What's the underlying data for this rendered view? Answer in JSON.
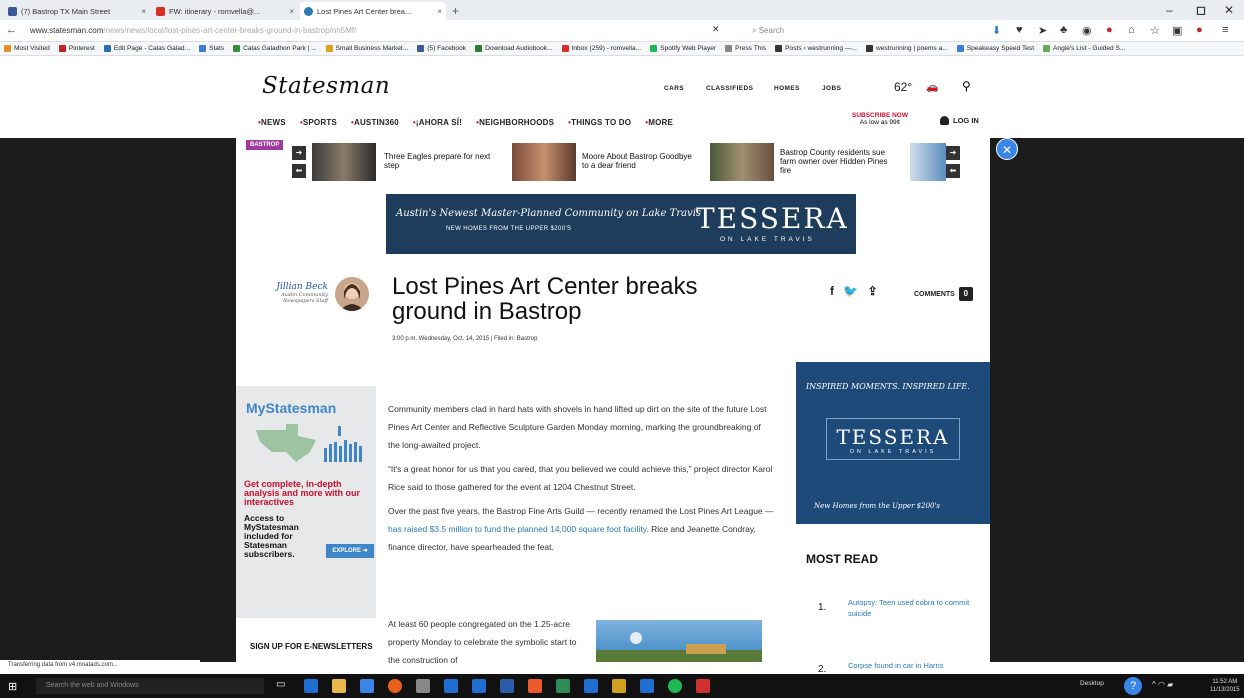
{
  "browser": {
    "tabs": [
      {
        "label": "(7) Bastrop TX Main Street",
        "close": "×",
        "color": "#3b5998"
      },
      {
        "label": "FW: itinerary - romvella@...",
        "close": "×",
        "color": "#d93025"
      },
      {
        "label": "Lost Pines Art Center brea...",
        "close": "×",
        "color": "#2a7ab8"
      }
    ],
    "new_tab": "+",
    "url_domain": "www.statesman.com",
    "url_path": "/news/news/local/lost-pines-art-center-breaks-ground-in-bastrop/nn5Mf/",
    "search_placeholder": "Search",
    "bookmarks": [
      {
        "label": "Most Visited",
        "color": "#e88d2a"
      },
      {
        "label": "Pinterest",
        "color": "#cb2027"
      },
      {
        "label": "Edit Page - Calas Galad...",
        "color": "#2a6fb0"
      },
      {
        "label": "Stats",
        "color": "#3b7dd8"
      },
      {
        "label": "Calas Galadhon Park | ...",
        "color": "#3a8c3a"
      },
      {
        "label": "Small Business Market...",
        "color": "#e0a020"
      },
      {
        "label": "(5) Facebook",
        "color": "#3b5998"
      },
      {
        "label": "Download Audiobook...",
        "color": "#2e7d32"
      },
      {
        "label": "Inbox (259) - romvella...",
        "color": "#d93025"
      },
      {
        "label": "Spotify Web Player",
        "color": "#1db954"
      },
      {
        "label": "Press This",
        "color": "#888888"
      },
      {
        "label": "Posts ‹ westrunning —...",
        "color": "#333333"
      },
      {
        "label": "westrunning | poems a...",
        "color": "#333333"
      },
      {
        "label": "Speakeasy Speed Test",
        "color": "#3b7dd8"
      },
      {
        "label": "Angie's List - Guided S...",
        "color": "#6aa84f"
      }
    ]
  },
  "site": {
    "logo": "Statesman",
    "header_links": [
      "CARS",
      "CLASSIFIEDS",
      "HOMES",
      "JOBS"
    ],
    "temperature": "62°",
    "menu": [
      "NEWS",
      "SPORTS",
      "AUSTIN360",
      "¡AHORA SÍ!",
      "NEIGHBORHOODS",
      "THINGS TO DO",
      "MORE"
    ],
    "subscribe_line1": "SUBSCRIBE NOW",
    "subscribe_line2": "As low as 99¢",
    "login": "LOG IN"
  },
  "related": {
    "tag": "BASTROP",
    "items": [
      "Three Eagles prepare for next step",
      "Moore About Bastrop Goodbye to a dear friend",
      "Bastrop County residents sue farm owner over Hidden Pines fire"
    ]
  },
  "ad_banner": {
    "line1": "Austin's Newest Master-Planned Community on Lake Travis",
    "line2": "NEW HOMES FROM THE UPPER $200'S",
    "brand": "TESSERA",
    "brand_sub": "ON LAKE TRAVIS"
  },
  "article": {
    "author_name": "Jillian Beck",
    "author_role": "Austin Community Newspapers Staff",
    "headline": "Lost Pines Art Center breaks ground in Bastrop",
    "dateline": "3:00 p.m. Wednesday, Oct. 14, 2015 | Filed in: Bastrop",
    "comments_label": "COMMENTS",
    "comments_count": "0",
    "p1": "Community members clad in hard hats with shovels in hand lifted up dirt on the site of the future Lost Pines Art Center and Reflective Sculpture Garden Monday morning, marking the groundbreaking of the long-awaited project.",
    "p2": "“It's a great honor for us that you cared, that you believed we could achieve this,” project director Karol Rice said to those gathered for the event at 1204 Chestnut Street.",
    "p3_a": "Over the past five years, the Bastrop Fine Arts Guild — recently renamed the Lost Pines Art League —",
    "p3_link": "has raised $3.5 million to fund the planned 14,000 square foot facility.",
    "p3_b": "Rice and Jeanette Condray, finance director, have spearheaded the feat.",
    "p4": "At least 60 people congregated on the 1.25-acre property Monday to celebrate the symbolic start to the construction of"
  },
  "promo": {
    "title": "MyStatesman",
    "red": "Get complete, in-depth analysis and more with our interactives",
    "black": "Access to MyStatesman included for Statesman subscribers.",
    "button": "EXPLORE ➜",
    "newsletters": "SIGN UP FOR E-NEWSLETTERS"
  },
  "right_ad": {
    "line1": "INSPIRED MOMENTS. INSPIRED LIFE.",
    "brand": "TESSERA",
    "brand_sub": "ON LAKE TRAVIS",
    "line3": "New Homes from the Upper $200's"
  },
  "most_read": {
    "title": "MOST READ",
    "items": [
      {
        "num": "1.",
        "text": "Autopsy: Teen used cobra to commit suicide"
      },
      {
        "num": "2.",
        "text": "Corpse found in car in Harris"
      }
    ]
  },
  "status_text": "Transferring data from v4.moatads.com...",
  "taskbar": {
    "search": "Search the web and Windows",
    "desktop": "Desktop",
    "time": "11:52 AM",
    "date": "11/13/2015"
  }
}
